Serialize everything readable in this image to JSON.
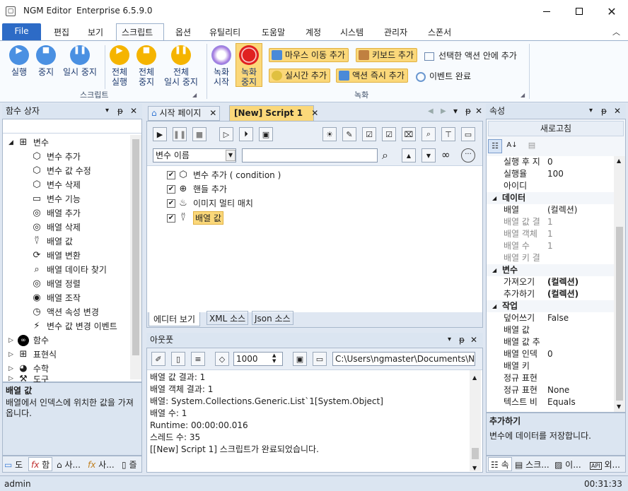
{
  "window": {
    "title": "NGM Editor",
    "edition": "Enterprise 6.5.9.0"
  },
  "menu": {
    "file": "File",
    "items": [
      "편집",
      "보기",
      "스크립트",
      "옵션",
      "유틸리티",
      "도움말",
      "계정",
      "시스템",
      "관리자",
      "스폰서"
    ]
  },
  "ribbon": {
    "run": "실행",
    "stop": "중지",
    "pause": "일시 중지",
    "run_all_1": "전체",
    "run_all_2": "실행",
    "stop_all_1": "전체",
    "stop_all_2": "중지",
    "pause_all_1": "전체",
    "pause_all_2": "일시 중지",
    "group_script": "스크립트",
    "rec_start_1": "녹화",
    "rec_start_2": "시작",
    "rec_stop_1": "녹화",
    "rec_stop_2": "중지",
    "mouse_move": "마우스 이동 추가",
    "keyboard": "키보드 추가",
    "selected_action": "선택한 액션 안에 추가",
    "realtime": "실시간 추가",
    "action_now": "액션 즉시 추가",
    "event_done": "이벤트 완료",
    "group_record": "녹화",
    "colors": {
      "blue": "#4a90e2",
      "yellow": "#f5b400",
      "red": "#e02020",
      "pill": "#fbd87a"
    }
  },
  "func_panel": {
    "title": "함수 상자",
    "root": "변수",
    "items": [
      "변수 추가",
      "변수 값 수정",
      "변수 삭제",
      "변수 기능",
      "배열 추가",
      "배열 삭제",
      "배열 값",
      "배열 변환",
      "배열 데이타 찾기",
      "배열 정렬",
      "배열 조작",
      "액션 속성 변경",
      "변수 값 변경 이벤트"
    ],
    "groups": [
      "함수",
      "표현식",
      "수학",
      "도구"
    ],
    "icons": [
      "cube-icon",
      "cube-edit-icon",
      "cube-delete-icon",
      "console-icon",
      "database-icon",
      "database-delete-icon",
      "pointer-icon",
      "convert-icon",
      "search-icon",
      "database-sort-icon",
      "toggle-icon",
      "timer-icon",
      "lightning-icon"
    ],
    "desc_title": "배열 값",
    "desc_text": "배열에서 인덱스에 위치한 값을 가져옵니다.",
    "bottom_tabs": [
      "도",
      "함",
      "사...",
      "사...",
      "즐"
    ]
  },
  "editor": {
    "tabs": [
      "시작 페이지",
      "[New] Script 1"
    ],
    "combo": "변수 이름",
    "search_value": "",
    "lines": [
      {
        "checked": "✔",
        "text": "변수 추가 ( condition )"
      },
      {
        "checked": "✔",
        "text": "핸들 추가"
      },
      {
        "checked": "✔",
        "text": "이미지 멀티 매치"
      },
      {
        "checked": "✔",
        "text": "배열 값"
      }
    ],
    "bottom_tabs": [
      "에디터 보기",
      "XML 소스",
      "Json 소스"
    ]
  },
  "output": {
    "title": "아웃풋",
    "count": "1000",
    "path": "C:\\Users\\ngmaster\\Documents\\NGM",
    "lines": [
      "배열 값 결과: 1",
      "배열 객체 결과: 1",
      "배열: System.Collections.Generic.List`1[System.Object]",
      "배열 수: 1",
      "Runtime: 00:00:00.016",
      "스레드 수: 35",
      "[[New] Script 1] 스크립트가 완료되었습니다."
    ]
  },
  "props": {
    "title": "속성",
    "refresh": "새로고침",
    "rows": [
      {
        "k": "실행 후 지",
        "v": "0",
        "cat": false,
        "dis": false
      },
      {
        "k": "실행율",
        "v": "100",
        "cat": false,
        "dis": false
      },
      {
        "k": "아이디",
        "v": "",
        "cat": false,
        "dis": false
      },
      {
        "k": "데이터",
        "v": "",
        "cat": true,
        "dis": false
      },
      {
        "k": "배열",
        "v": "(컬렉션)",
        "cat": false,
        "dis": false
      },
      {
        "k": "배열 값 결",
        "v": "1",
        "cat": false,
        "dis": true
      },
      {
        "k": "배열 객체",
        "v": "1",
        "cat": false,
        "dis": true
      },
      {
        "k": "배열 수",
        "v": "1",
        "cat": false,
        "dis": true
      },
      {
        "k": "배열 키 결",
        "v": "",
        "cat": false,
        "dis": true
      },
      {
        "k": "변수",
        "v": "",
        "cat": true,
        "dis": false
      },
      {
        "k": "가져오기",
        "v": "(컬렉션)",
        "cat": false,
        "dis": false,
        "bold": true
      },
      {
        "k": "추가하기",
        "v": "(컬렉션)",
        "cat": false,
        "dis": false,
        "bold": true
      },
      {
        "k": "작업",
        "v": "",
        "cat": true,
        "dis": false
      },
      {
        "k": "덮어쓰기",
        "v": "False",
        "cat": false,
        "dis": false
      },
      {
        "k": "배열 값",
        "v": "",
        "cat": false,
        "dis": false
      },
      {
        "k": "배열 값 추",
        "v": "",
        "cat": false,
        "dis": false
      },
      {
        "k": "배열 인덱",
        "v": "0",
        "cat": false,
        "dis": false
      },
      {
        "k": "배열 키",
        "v": "",
        "cat": false,
        "dis": false
      },
      {
        "k": "정규 표현",
        "v": "",
        "cat": false,
        "dis": false
      },
      {
        "k": "정규 표현",
        "v": "None",
        "cat": false,
        "dis": false
      },
      {
        "k": "텍스트 비",
        "v": "Equals",
        "cat": false,
        "dis": false
      }
    ],
    "desc_title": "추가하기",
    "desc_text": "변수에 데이터를 저장합니다.",
    "bottom_tabs": [
      "속",
      "스크...",
      "이...",
      "외..."
    ]
  },
  "status": {
    "user": "admin",
    "time": "00:31:33"
  }
}
